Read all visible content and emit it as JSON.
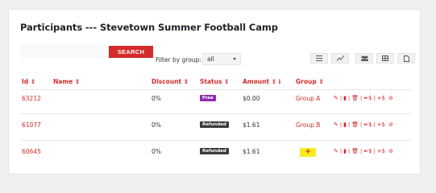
{
  "page": {
    "title": "Participants --- Stevetown Summer Football Camp"
  },
  "search": {
    "placeholder": "",
    "button_label": "SEARCH"
  },
  "filter": {
    "label": "Filter by group:",
    "selected": "all"
  },
  "toolbar": {
    "icons": [
      "list-icon",
      "chart-icon",
      "group-icon",
      "table-icon",
      "document-icon"
    ]
  },
  "table": {
    "headers": {
      "id": "Id ⇕",
      "name": "Name ⇕",
      "discount": "Discount ⇕",
      "status": "Status ⇕",
      "amount": "Amount ⇕ ℹ",
      "group": "Group ⇕"
    },
    "rows": [
      {
        "id": "63212",
        "name": "",
        "discount": "0%",
        "status": "Free",
        "amount": "$0.00",
        "group": "Group A"
      },
      {
        "id": "61077",
        "name": "",
        "discount": "0%",
        "status": "Refunded",
        "amount": "$1.61",
        "group": "Group B"
      },
      {
        "id": "60645",
        "name": "",
        "discount": "0%",
        "status": "Refunded",
        "amount": "$1.61",
        "group": "+"
      }
    ],
    "actions": {
      "edit": "✎",
      "view": "▮",
      "delete": "🗑",
      "refund": "↞$",
      "charge": "+$",
      "cancel": "⊘",
      "separator": "|"
    }
  },
  "colors": {
    "accent": "#d32a2a",
    "badge_free": "#8e2bb1",
    "badge_refunded": "#3a3a3a",
    "add_group": "#f8eb1f"
  }
}
